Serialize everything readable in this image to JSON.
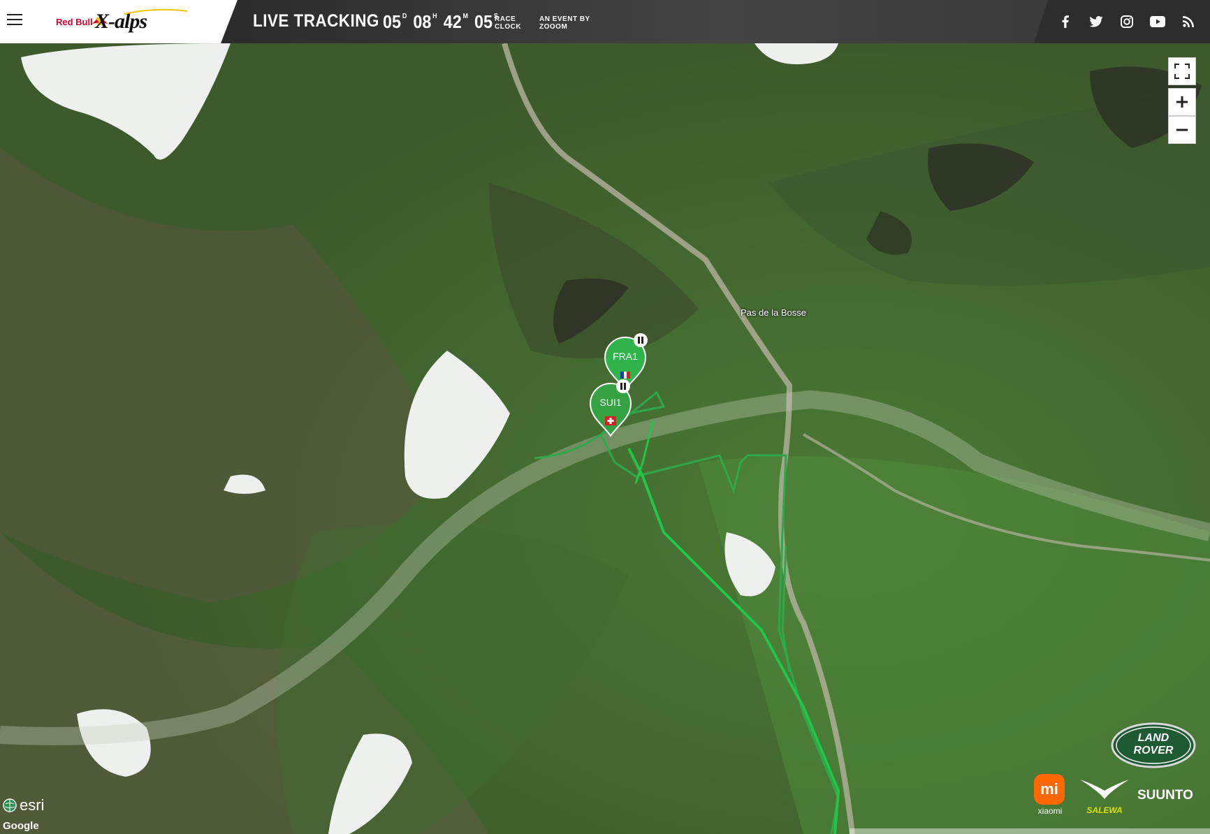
{
  "header": {
    "brand_redbull": "Red Bull",
    "brand_xalps": "X-alps",
    "title": "LIVE TRACKING",
    "clock": {
      "days": "05",
      "days_unit": "D",
      "hours": "08",
      "hours_unit": "H",
      "minutes": "42",
      "minutes_unit": "M",
      "seconds": "05",
      "seconds_unit": "S"
    },
    "clock_label_1": "RACE",
    "clock_label_2": "CLOCK",
    "event_label_1": "AN EVENT BY",
    "event_label_2": "ZOOOM"
  },
  "social": [
    "facebook-icon",
    "twitter-icon",
    "instagram-icon",
    "youtube-icon",
    "rss-icon"
  ],
  "map": {
    "place_label": "Pas de la Bosse",
    "markers": [
      {
        "label": "FRA1",
        "flag": "france",
        "color": "#2fb34a",
        "status": "paused"
      },
      {
        "label": "SUI1",
        "flag": "switzerland",
        "color": "#35a244",
        "status": "paused"
      }
    ],
    "controls": {
      "fullscreen": "fullscreen-icon",
      "zoom_in": "+",
      "zoom_out": "−"
    },
    "esri_label": "esri",
    "google_label": "Google"
  },
  "sponsors": {
    "land_rover": "LAND ROVER",
    "xiaomi_logo": "mi",
    "xiaomi": "xiaomi",
    "salewa": "SALEWA",
    "suunto": "SUUNTO"
  },
  "colors": {
    "track_green": "#22c44a",
    "accent": "#2fb34a"
  }
}
